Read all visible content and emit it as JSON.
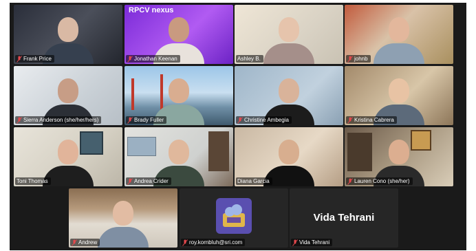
{
  "participants": [
    {
      "name": "Frank Price",
      "muted": true
    },
    {
      "name": "Jonathan Keenan",
      "muted": true,
      "background_text": "RPCV nexus"
    },
    {
      "name": "Ashley B.",
      "muted": true
    },
    {
      "name": "johnb",
      "muted": true
    },
    {
      "name": "Sierra Anderson (she/her/hers)",
      "muted": true
    },
    {
      "name": "Brady Fuller",
      "muted": true
    },
    {
      "name": "Christine Ambegia",
      "muted": true
    },
    {
      "name": "Kristina Cabrera",
      "muted": true
    },
    {
      "name": "Toni Thomas",
      "muted": false,
      "active_speaker": true
    },
    {
      "name": "Andrea Crider",
      "muted": true
    },
    {
      "name": "Diana Garcia",
      "muted": false
    },
    {
      "name": "Lauren Cono (she/her)",
      "muted": true
    },
    {
      "name": "Andrew",
      "muted": true
    },
    {
      "name": "roy.kornbluh@sri.com",
      "muted": true
    },
    {
      "name": "Vida Tehrani",
      "muted": true,
      "display_name": "Vida Tehrani"
    }
  ],
  "colors": {
    "active_border": "#2fb57c",
    "muted_mic": "#e5484d",
    "grid_bg": "#1a1a1a"
  }
}
